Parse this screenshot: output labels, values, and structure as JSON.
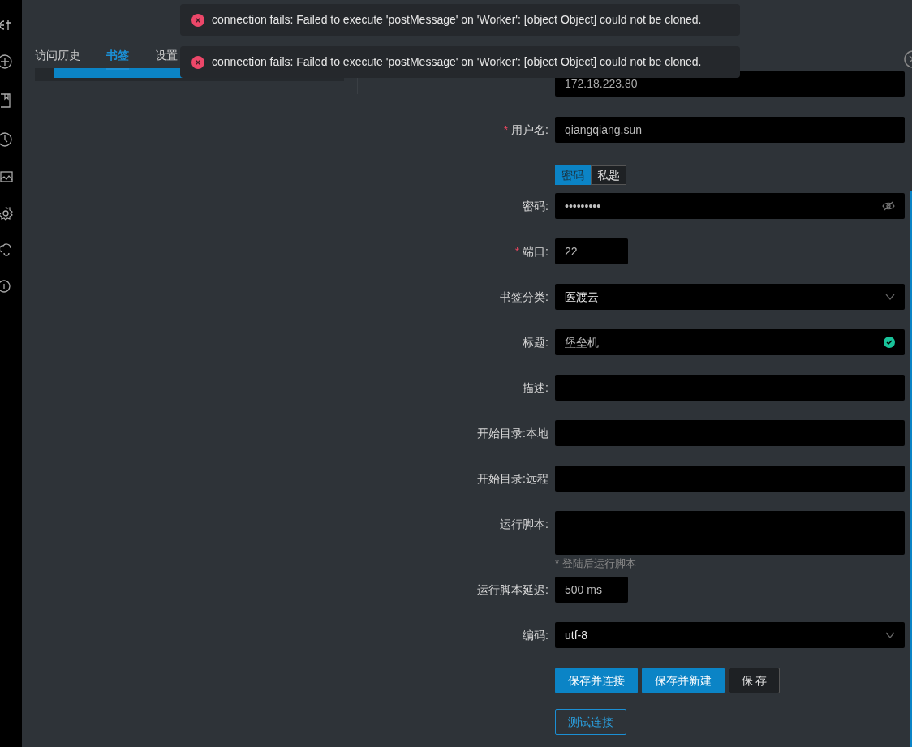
{
  "sidebar": {
    "icons": [
      {
        "kind": "logo"
      },
      {
        "kind": "plus"
      },
      {
        "kind": "bookmark"
      },
      {
        "kind": "clock"
      },
      {
        "kind": "image"
      },
      {
        "kind": "gear"
      },
      {
        "kind": "cloud"
      },
      {
        "kind": "info"
      }
    ]
  },
  "tabs": [
    {
      "label": "访问历史",
      "selected": false
    },
    {
      "label": "书签",
      "selected": true
    },
    {
      "label": "设置",
      "selected": false
    }
  ],
  "bookmarks": [
    {
      "selected": true
    }
  ],
  "form": {
    "host_value": "172.18.223.80",
    "fields": [
      {
        "kind": "text",
        "label": "用户名:",
        "required_mark": "*",
        "value": "qiangqiang.sun"
      },
      {
        "kind": "toggle",
        "options": [
          {
            "label": "密码",
            "selected": true
          },
          {
            "label": "私匙",
            "selected": false
          }
        ]
      },
      {
        "kind": "password",
        "label": "密码:",
        "value": "•••••••••"
      },
      {
        "kind": "short",
        "label": "端口:",
        "required_mark": "*",
        "value": "22"
      },
      {
        "kind": "select",
        "label": "书签分类:",
        "value": "医渡云"
      },
      {
        "kind": "valid",
        "label": "标题:",
        "value": "堡垒机"
      },
      {
        "kind": "textarea",
        "label": "描述:"
      },
      {
        "kind": "text",
        "label": "开始目录:本地"
      },
      {
        "kind": "text",
        "label": "开始目录:远程"
      },
      {
        "kind": "tallarea",
        "label": "运行脚本:",
        "hint": "* 登陆后运行脚本"
      },
      {
        "kind": "short",
        "label": "运行脚本延迟:",
        "value": "500 ms"
      },
      {
        "kind": "select",
        "label": "编码:",
        "value": "utf-8"
      }
    ],
    "buttons": [
      {
        "label": "保存并连接",
        "kind": "primary"
      },
      {
        "label": "保存并新建",
        "kind": "primary"
      },
      {
        "label": "保 存",
        "kind": "default"
      }
    ],
    "test_button": "测试连接"
  },
  "toasts": [
    {
      "message": "connection fails: Failed to execute 'postMessage' on 'Worker': [object Object] could not be cloned."
    },
    {
      "message": "connection fails: Failed to execute 'postMessage' on 'Worker': [object Object] could not be cloned."
    }
  ]
}
